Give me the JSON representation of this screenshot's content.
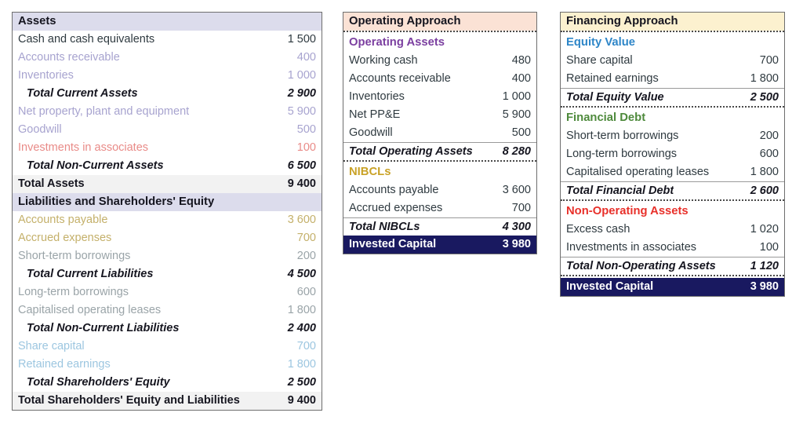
{
  "colors": {
    "header_lavender": "#dcdcec",
    "header_peach": "#fbe2d5",
    "header_cream": "#fcf1cf",
    "navy": "#191960",
    "purple": "#7b3fa0",
    "gold": "#c9a227",
    "blue": "#2e86c8",
    "green": "#4e8a3c",
    "red": "#e8302a",
    "salmon": "#e98b88",
    "lilac": "#a7a3cf",
    "gray": "#7d8a8f",
    "lightblue": "#9cc6e0",
    "tan": "#c4b06a",
    "dark": "#2f3a40"
  },
  "panels": {
    "assets": {
      "title": "Assets",
      "rows": [
        {
          "label": "Cash and cash equivalents",
          "value": "1 500",
          "style": "item",
          "color": "#2f3a40"
        },
        {
          "label": "Accounts receivable",
          "value": "400",
          "style": "item",
          "color": "#a7a3cf"
        },
        {
          "label": "Inventories",
          "value": "1 000",
          "style": "item",
          "color": "#a7a3cf"
        },
        {
          "label": "Total Current Assets",
          "value": "2 900",
          "style": "subtotal",
          "color": "#15151f"
        },
        {
          "label": "Net property, plant and equipment",
          "value": "5 900",
          "style": "item",
          "color": "#a7a3cf"
        },
        {
          "label": "Goodwill",
          "value": "500",
          "style": "item",
          "color": "#a7a3cf"
        },
        {
          "label": "Investments in associates",
          "value": "100",
          "style": "item",
          "color": "#e98b88"
        },
        {
          "label": "Total Non-Current Assets",
          "value": "6 500",
          "style": "subtotal",
          "color": "#15151f"
        },
        {
          "label": "Total Assets",
          "value": "9 400",
          "style": "grandtotal",
          "color": "#15151f"
        }
      ],
      "subtitle": "Liabilities and Shareholders' Equity",
      "rows2": [
        {
          "label": "Accounts payable",
          "value": "3 600",
          "style": "item",
          "color": "#c4b06a"
        },
        {
          "label": "Accrued expenses",
          "value": "700",
          "style": "item",
          "color": "#c4b06a"
        },
        {
          "label": "Short-term borrowings",
          "value": "200",
          "style": "item",
          "color": "#9aa4a8"
        },
        {
          "label": "Total Current Liabilities",
          "value": "4 500",
          "style": "subtotal",
          "color": "#15151f"
        },
        {
          "label": "Long-term borrowings",
          "value": "600",
          "style": "item",
          "color": "#9aa4a8"
        },
        {
          "label": "Capitalised operating leases",
          "value": "1 800",
          "style": "item",
          "color": "#9aa4a8"
        },
        {
          "label": "Total Non-Current Liabilities",
          "value": "2 400",
          "style": "subtotal",
          "color": "#15151f"
        },
        {
          "label": "Share capital",
          "value": "700",
          "style": "item",
          "color": "#9cc6e0"
        },
        {
          "label": "Retained earnings",
          "value": "1 800",
          "style": "item",
          "color": "#9cc6e0"
        },
        {
          "label": "Total Shareholders' Equity",
          "value": "2 500",
          "style": "subtotal",
          "color": "#15151f"
        },
        {
          "label": "Total Shareholders' Equity and Liabilities",
          "value": "9 400",
          "style": "grandtotal",
          "color": "#15151f"
        }
      ]
    },
    "operating": {
      "title": "Operating Approach",
      "group1_title": "Operating Assets",
      "group1_rows": [
        {
          "label": "Working cash",
          "value": "480"
        },
        {
          "label": "Accounts receivable",
          "value": "400"
        },
        {
          "label": "Inventories",
          "value": "1 000"
        },
        {
          "label": "Net PP&E",
          "value": "5 900"
        },
        {
          "label": "Goodwill",
          "value": "500"
        }
      ],
      "group1_total_label": "Total Operating Assets",
      "group1_total_value": "8 280",
      "group2_title": "NIBCLs",
      "group2_rows": [
        {
          "label": "Accounts payable",
          "value": "3 600"
        },
        {
          "label": "Accrued expenses",
          "value": "700"
        }
      ],
      "group2_total_label": "Total NIBCLs",
      "group2_total_value": "4 300",
      "final_label": "Invested Capital",
      "final_value": "3 980"
    },
    "financing": {
      "title": "Financing Approach",
      "group1_title": "Equity Value",
      "group1_rows": [
        {
          "label": "Share capital",
          "value": "700"
        },
        {
          "label": "Retained earnings",
          "value": "1 800"
        }
      ],
      "group1_total_label": "Total Equity Value",
      "group1_total_value": "2 500",
      "group2_title": "Financial Debt",
      "group2_rows": [
        {
          "label": "Short-term borrowings",
          "value": "200"
        },
        {
          "label": "Long-term borrowings",
          "value": "600"
        },
        {
          "label": "Capitalised operating leases",
          "value": "1 800"
        }
      ],
      "group2_total_label": "Total Financial Debt",
      "group2_total_value": "2 600",
      "group3_title": "Non-Operating Assets",
      "group3_rows": [
        {
          "label": "Excess cash",
          "value": "1 020"
        },
        {
          "label": "Investments in associates",
          "value": "100"
        }
      ],
      "group3_total_label": "Total Non-Operating Assets",
      "group3_total_value": "1 120",
      "final_label": "Invested Capital",
      "final_value": "3 980"
    }
  }
}
